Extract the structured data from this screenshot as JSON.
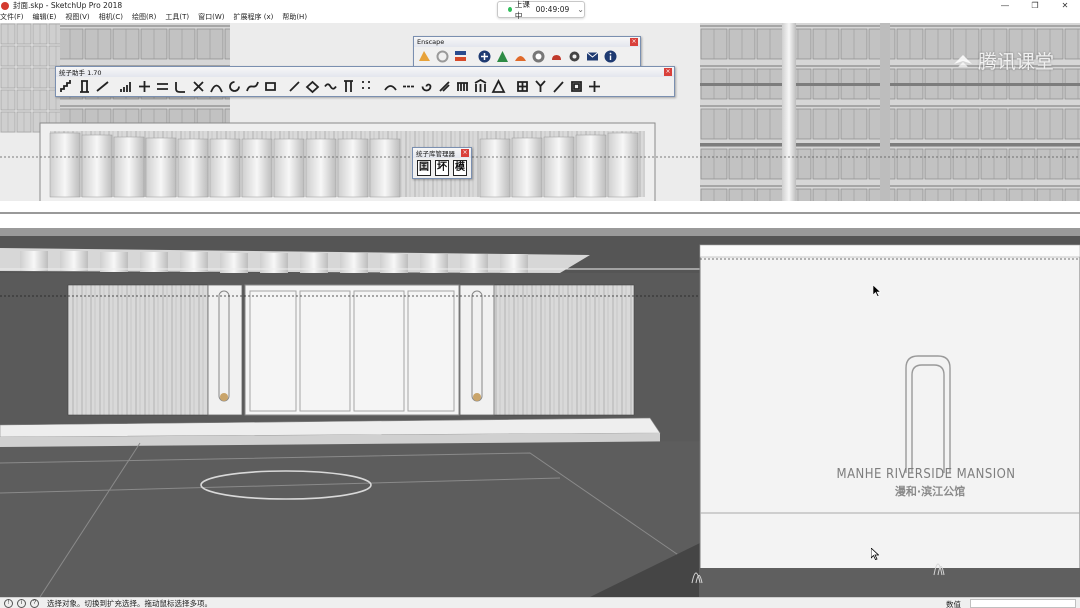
{
  "window": {
    "title": "封面.skp - SketchUp Pro 2018",
    "controls": [
      "—",
      "❐",
      "✕"
    ]
  },
  "menu": [
    "文件(F)",
    "编辑(E)",
    "视图(V)",
    "相机(C)",
    "绘图(R)",
    "工具(T)",
    "窗口(W)",
    "扩展程序 (x)",
    "帮助(H)"
  ],
  "class_status": {
    "label": "上课中",
    "time": "00:49:09"
  },
  "watermark": "腾讯课堂",
  "toolbars": {
    "enscape": {
      "title": "Enscape"
    },
    "helper": {
      "title": "统子助手 1.70"
    },
    "library": {
      "title": "统子库管理器",
      "buttons": [
        "囯",
        "坏",
        "模"
      ]
    }
  },
  "sign": {
    "line1": "MANHE RIVERSIDE MANSION",
    "line2": "漫和·滨江公馆"
  },
  "status_bar": {
    "hint": "选择对象。切换到扩充选择。拖动鼠标选择多项。",
    "measure_label": "数值",
    "measure_value": ""
  },
  "colors": {
    "accent_close": "#d9403a",
    "live_dot": "#2fbf5a"
  }
}
